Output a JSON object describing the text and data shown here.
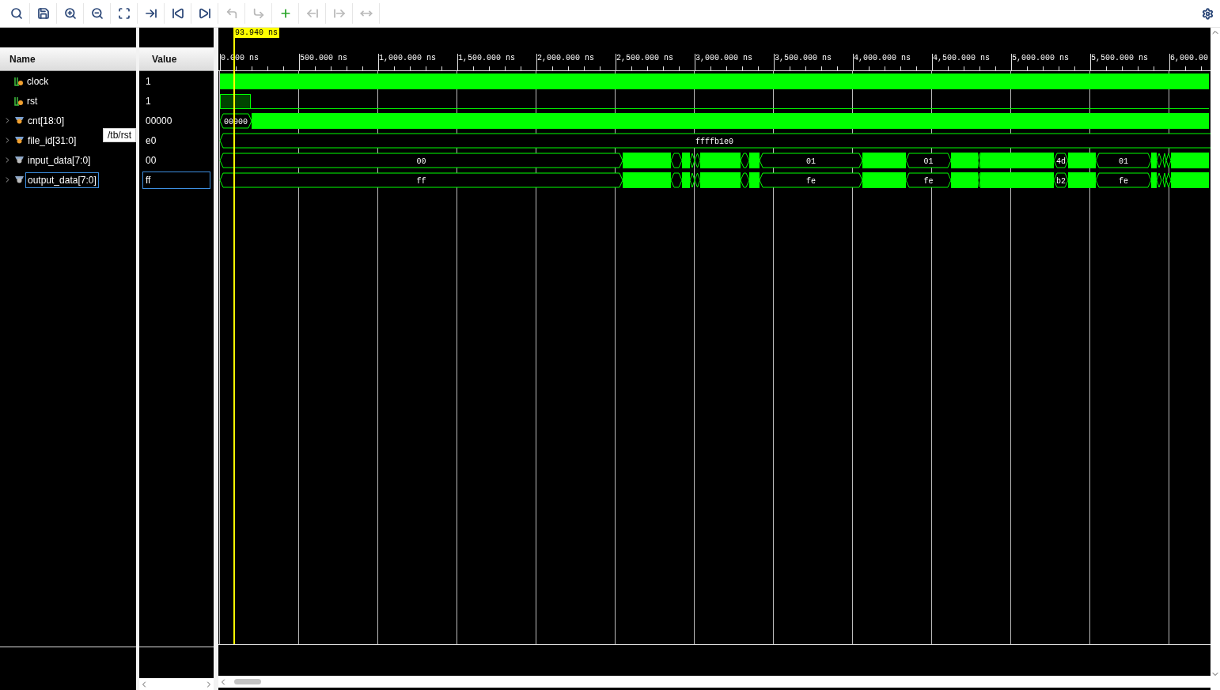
{
  "toolbar": [
    {
      "kind": "search",
      "disabled": false
    },
    {
      "kind": "save",
      "disabled": false
    },
    {
      "kind": "zoom_in",
      "disabled": false
    },
    {
      "kind": "zoom_out",
      "disabled": false
    },
    {
      "kind": "zoom_fit",
      "disabled": false
    },
    {
      "kind": "go_to_cursor",
      "disabled": false
    },
    {
      "kind": "go_to_start",
      "disabled": false
    },
    {
      "kind": "go_to_end",
      "disabled": false
    },
    {
      "kind": "previous_transition",
      "disabled": true
    },
    {
      "kind": "next_transition",
      "disabled": true
    },
    {
      "kind": "add_marker",
      "disabled": false
    },
    {
      "kind": "previous_marker",
      "disabled": true
    },
    {
      "kind": "next_marker",
      "disabled": true
    },
    {
      "kind": "swap_cursors",
      "disabled": true
    }
  ],
  "columns": {
    "name": "Name",
    "value": "Value"
  },
  "signals": [
    {
      "name": "clock",
      "value": "1",
      "kind": "bit",
      "selected": false
    },
    {
      "name": "rst",
      "value": "1",
      "kind": "bit",
      "selected": false
    },
    {
      "name": "cnt[18:0]",
      "value": "00000",
      "kind": "bus",
      "selected": false,
      "wave_labels": [
        "00000"
      ]
    },
    {
      "name": "file_id[31:0]",
      "value": "e0",
      "kind": "bus",
      "selected": false,
      "wave_labels": [
        "ffffb1e0"
      ]
    },
    {
      "name": "input_data[7:0]",
      "value": "00",
      "kind": "port_bus",
      "selected": false,
      "wave_labels": [
        "00",
        "01",
        "01",
        "4d",
        "01"
      ]
    },
    {
      "name": "output_data[7:0]",
      "value": "ff",
      "kind": "port_bus",
      "selected": true,
      "wave_labels": [
        "ff",
        "fe",
        "fe",
        "b2",
        "fe"
      ]
    }
  ],
  "tooltip": "/tb/rst",
  "cursor": {
    "label": "93.940 ns"
  },
  "ticks": [
    "0.000 ns",
    "500.000 ns",
    "1,000.000 ns",
    "1,500.000 ns",
    "2,000.000 ns",
    "2,500.000 ns",
    "3,000.000 ns",
    "3,500.000 ns",
    "4,000.000 ns",
    "4,500.000 ns",
    "5,000.000 ns",
    "5,500.000 ns",
    "6,000.00"
  ]
}
